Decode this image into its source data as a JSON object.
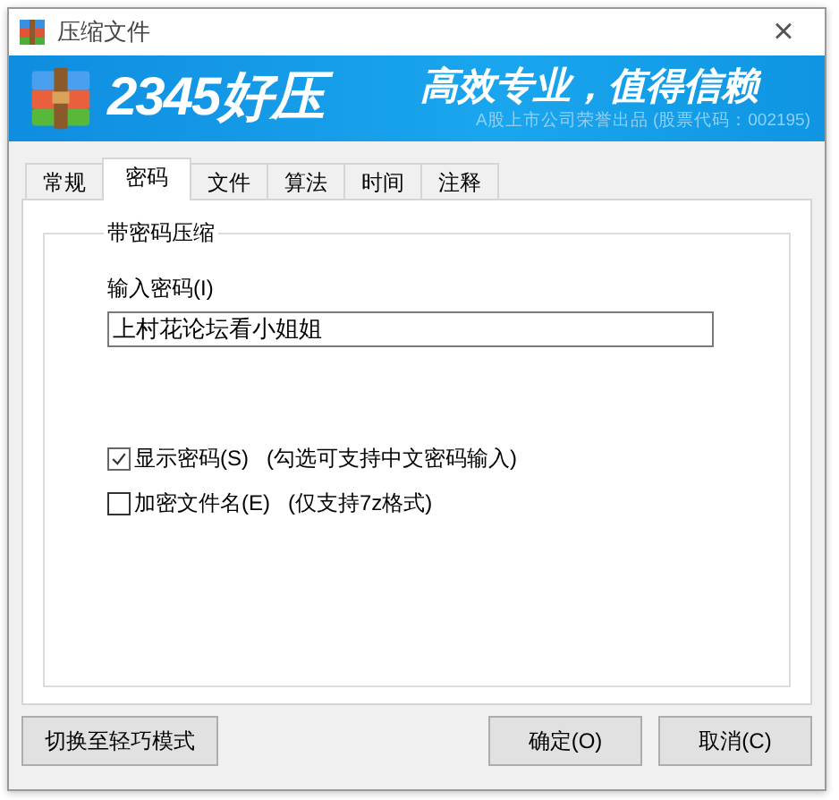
{
  "window": {
    "title": "压缩文件",
    "close": "×"
  },
  "banner": {
    "logo": "2345好压",
    "slogan": "高效专业，值得信赖",
    "subtitle": "A股上市公司荣誉出品 (股票代码：002195)"
  },
  "tabs": [
    {
      "label": "常规",
      "selected": false
    },
    {
      "label": "密码",
      "selected": true
    },
    {
      "label": "文件",
      "selected": false
    },
    {
      "label": "算法",
      "selected": false
    },
    {
      "label": "时间",
      "selected": false
    },
    {
      "label": "注释",
      "selected": false
    }
  ],
  "group": {
    "title": "带密码压缩",
    "password_label": "输入密码(I)",
    "password_value": "上村花论坛看小姐姐",
    "options": [
      {
        "label": "显示密码(S)",
        "note": "(勾选可支持中文密码输入)",
        "checked": true
      },
      {
        "label": "加密文件名(E)",
        "note": "(仅支持7z格式)",
        "checked": false
      }
    ]
  },
  "buttons": {
    "mode": "切换至轻巧模式",
    "ok": "确定(O)",
    "cancel": "取消(C)"
  }
}
